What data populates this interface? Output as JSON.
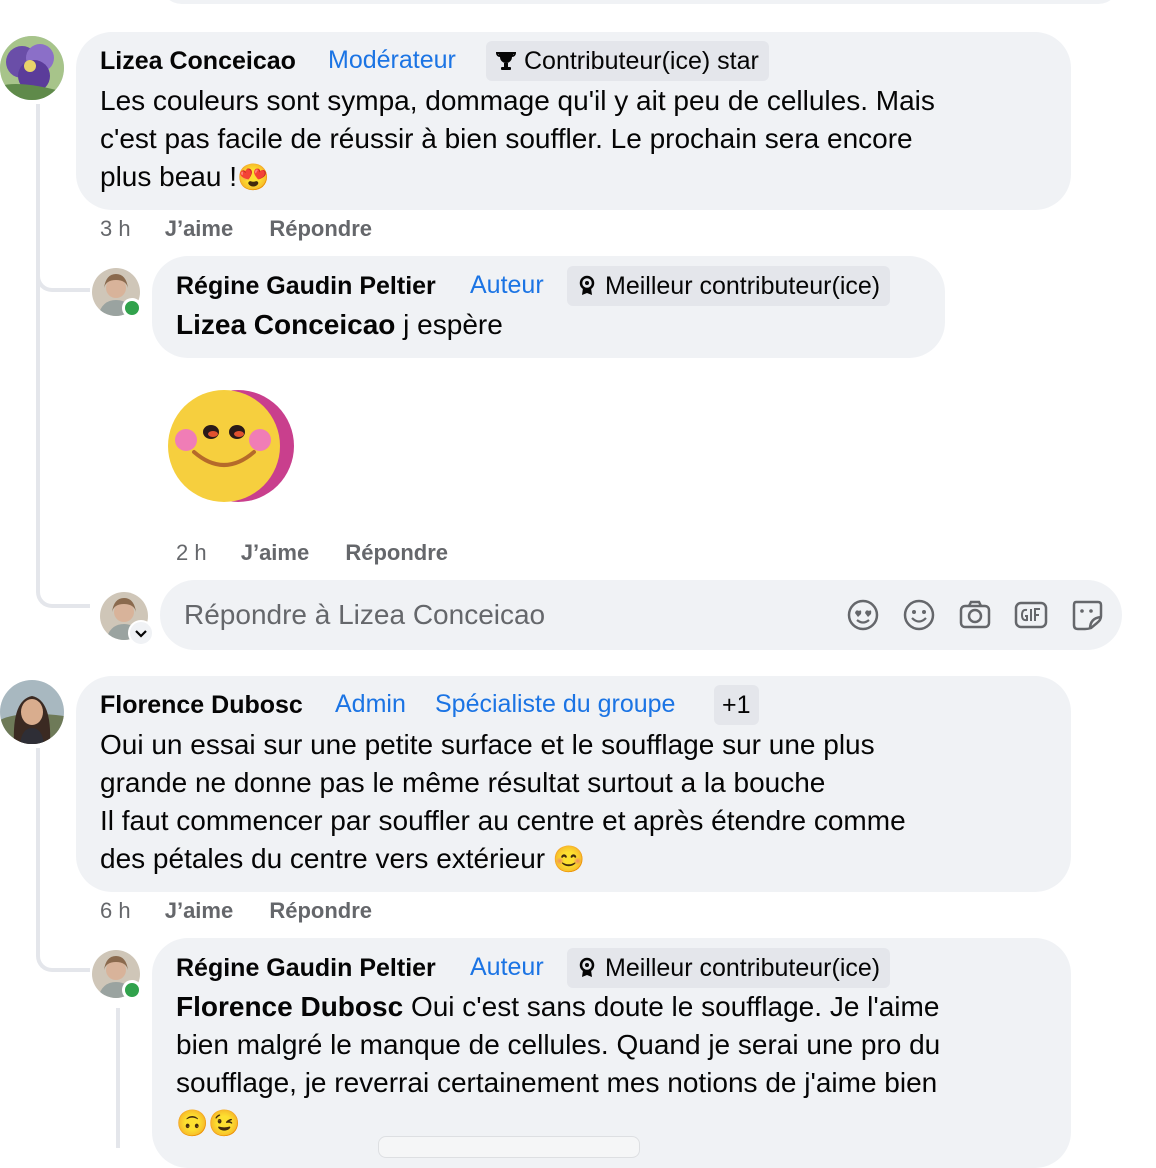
{
  "comments": [
    {
      "author": "Lizea Conceicao",
      "badge_blue": "Modérateur",
      "badge_gray": "Contributeur(ice) star",
      "lines": [
        "Les couleurs sont sympa, dommage qu'il y ait peu de cellules. Mais",
        "c'est pas facile de réussir à bien souffler. Le prochain sera encore",
        "plus beau !"
      ],
      "emoji": "😍",
      "time": "3 h",
      "like": "J’aime",
      "reply": "Répondre"
    },
    {
      "author": "Régine Gaudin Peltier",
      "badge_blue": "Auteur",
      "badge_gray": "Meilleur contributeur(ice)",
      "mention": "Lizea Conceicao",
      "text": " j espère",
      "time": "2 h",
      "like": "J’aime",
      "reply": "Répondre"
    },
    {
      "author": "Florence Dubosc",
      "badge_blue": "Admin",
      "badge_blue_2": "Spécialiste du groupe",
      "badge_more": "+1",
      "lines": [
        "Oui un essai sur une petite surface et le soufflage sur une plus",
        "grande ne donne pas le même résultat surtout a la bouche",
        "Il faut commencer par souffler au centre et après étendre comme",
        "des pétales du centre vers extérieur "
      ],
      "emoji": "😊",
      "time": "6 h",
      "like": "J’aime",
      "reply": "Répondre"
    },
    {
      "author": "Régine Gaudin Peltier",
      "badge_blue": "Auteur",
      "badge_gray": "Meilleur contributeur(ice)",
      "mention": "Florence Dubosc",
      "lines": [
        " Oui c'est sans doute le soufflage. Je l'aime",
        "bien malgré le manque de cellules. Quand je serai une pro du",
        "soufflage, je reverrai certainement mes notions de j'aime bien"
      ],
      "emoji_line": "🙃😉"
    }
  ],
  "reply_box": {
    "placeholder": "Répondre à Lizea Conceicao",
    "icons": [
      "avatar-sticker-icon",
      "emoji-icon",
      "camera-icon",
      "gif-icon",
      "sticker-icon"
    ]
  },
  "colors": {
    "badge_blue": "#1b74e4",
    "bubble": "#f0f2f5",
    "meta": "#65676b",
    "online": "#31a24c"
  }
}
